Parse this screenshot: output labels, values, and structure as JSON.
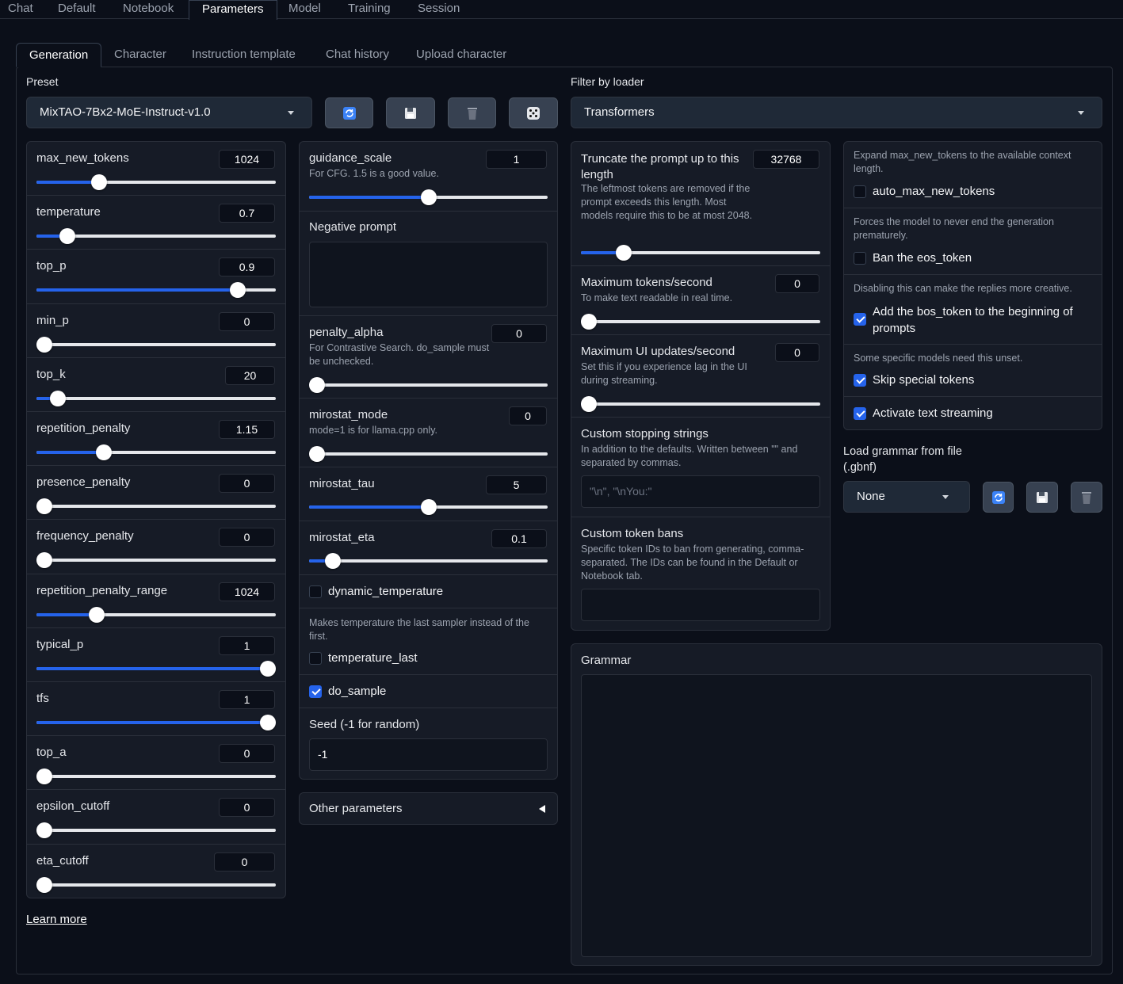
{
  "top_tabs": [
    "Chat",
    "Default",
    "Notebook",
    "Parameters",
    "Model",
    "Training",
    "Session"
  ],
  "sub_tabs": [
    "Generation",
    "Character",
    "Instruction template",
    "Chat history",
    "Upload character"
  ],
  "preset": {
    "label": "Preset",
    "value": "MixTAO-7Bx2-MoE-Instruct-v1.0"
  },
  "loader_filter": {
    "label": "Filter by loader",
    "value": "Transformers"
  },
  "sliders_left": [
    {
      "name": "max_new_tokens",
      "value": "1024",
      "fill": 0.26
    },
    {
      "name": "temperature",
      "value": "0.7",
      "fill": 0.13
    },
    {
      "name": "top_p",
      "value": "0.9",
      "fill": 0.84
    },
    {
      "name": "min_p",
      "value": "0",
      "fill": 0
    },
    {
      "name": "top_k",
      "value": "20",
      "fill": 0.09
    },
    {
      "name": "repetition_penalty",
      "value": "1.15",
      "fill": 0.28
    },
    {
      "name": "presence_penalty",
      "value": "0",
      "fill": 0
    },
    {
      "name": "frequency_penalty",
      "value": "0",
      "fill": 0
    },
    {
      "name": "repetition_penalty_range",
      "value": "1024",
      "fill": 0.25
    },
    {
      "name": "typical_p",
      "value": "1",
      "fill": 1
    },
    {
      "name": "tfs",
      "value": "1",
      "fill": 1
    },
    {
      "name": "top_a",
      "value": "0",
      "fill": 0
    },
    {
      "name": "epsilon_cutoff",
      "value": "0",
      "fill": 0
    },
    {
      "name": "eta_cutoff",
      "value": "0",
      "fill": 0
    }
  ],
  "mid": {
    "guidance_scale": {
      "name": "guidance_scale",
      "info": "For CFG. 1.5 is a good value.",
      "value": "1",
      "fill": 0.5
    },
    "negative_prompt_label": "Negative prompt",
    "penalty_alpha": {
      "name": "penalty_alpha",
      "info": "For Contrastive Search. do_sample must be unchecked.",
      "value": "0",
      "fill": 0
    },
    "mirostat_mode": {
      "name": "mirostat_mode",
      "info": "mode=1 is for llama.cpp only.",
      "value": "0",
      "fill": 0
    },
    "mirostat_tau": {
      "name": "mirostat_tau",
      "value": "5",
      "fill": 0.5
    },
    "mirostat_eta": {
      "name": "mirostat_eta",
      "value": "0.1",
      "fill": 0.1
    },
    "dynamic_temperature": "dynamic_temperature",
    "temperature_last_info": "Makes temperature the last sampler instead of the first.",
    "temperature_last": "temperature_last",
    "do_sample": "do_sample",
    "seed_label": "Seed (-1 for random)",
    "seed_value": "-1",
    "other_params": "Other parameters"
  },
  "right": {
    "truncate": {
      "name": "Truncate the prompt up to this length",
      "info": "The leftmost tokens are removed if the prompt exceeds this length. Most models require this to be at most 2048.",
      "value": "32768",
      "fill": 0.18
    },
    "max_tps": {
      "name": "Maximum tokens/second",
      "info": "To make text readable in real time.",
      "value": "0",
      "fill": 0
    },
    "max_ui": {
      "name": "Maximum UI updates/second",
      "info": "Set this if you experience lag in the UI during streaming.",
      "value": "0",
      "fill": 0
    },
    "stop_label": "Custom stopping strings",
    "stop_info": "In addition to the defaults. Written between \"\" and separated by commas.",
    "stop_placeholder": "\"\\n\", \"\\nYou:\"",
    "bans_label": "Custom token bans",
    "bans_info": "Specific token IDs to ban from generating, comma-separated. The IDs can be found in the Default or Notebook tab.",
    "grammar_label": "Grammar"
  },
  "checks": {
    "auto_info": "Expand max_new_tokens to the available context length.",
    "auto_label": "auto_max_new_tokens",
    "eos_info": "Forces the model to never end the generation prematurely.",
    "eos_label": "Ban the eos_token",
    "bos_info": "Disabling this can make the replies more creative.",
    "bos_label": "Add the bos_token to the beginning of prompts",
    "skip_info": "Some specific models need this unset.",
    "skip_label": "Skip special tokens",
    "stream_label": "Activate text streaming"
  },
  "grammar_file": {
    "label": "Load grammar from file (.gbnf)",
    "value": "None"
  },
  "learn_more": "Learn more"
}
